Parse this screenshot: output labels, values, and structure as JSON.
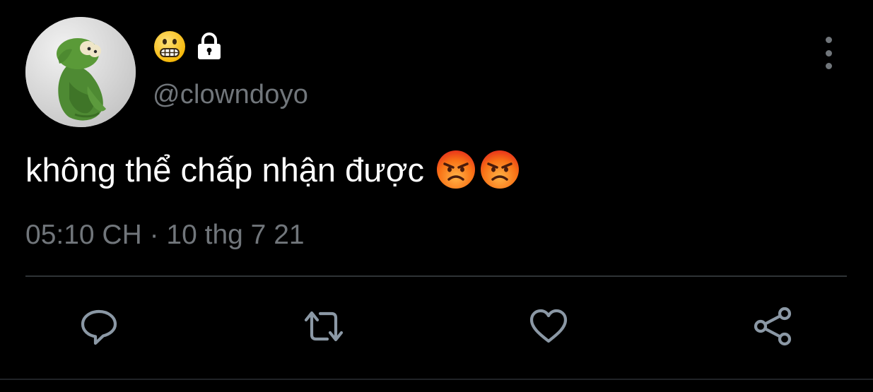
{
  "tweet": {
    "avatar": "kermit-avatar",
    "name_icons": [
      "grimacing-face-icon",
      "lock-icon"
    ],
    "handle": "@clowndoyo",
    "text": "không thể chấp nhận được",
    "text_emojis": [
      "angry-face-icon",
      "angry-face-icon"
    ],
    "time": "05:10 CH",
    "separator": "·",
    "date": "10 thg 7 21",
    "meta_line": "05:10 CH · 10 thg 7 21"
  },
  "actions": [
    {
      "icon": "reply-icon"
    },
    {
      "icon": "retweet-icon"
    },
    {
      "icon": "like-icon"
    },
    {
      "icon": "share-icon"
    }
  ],
  "colors": {
    "background": "#000000",
    "primary_text": "#ffffff",
    "secondary_text": "#71767b",
    "divider": "#2f3336"
  }
}
